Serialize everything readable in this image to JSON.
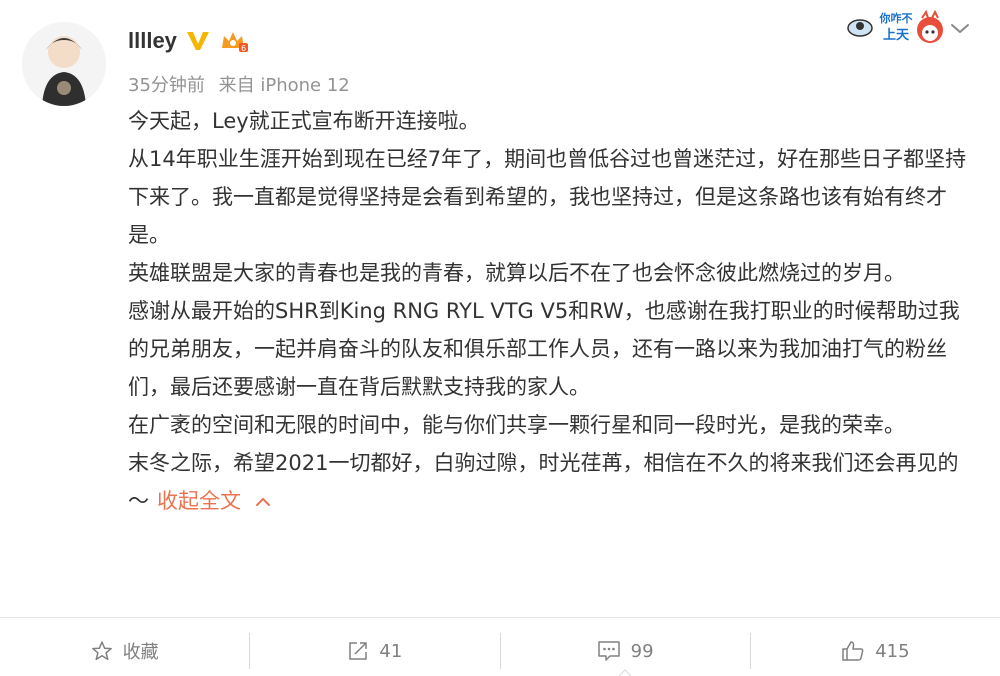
{
  "post": {
    "username": "lllley",
    "timestamp": "35分钟前",
    "source": "来自 iPhone 12",
    "paragraphs": [
      "今天起，Ley就正式宣布断开连接啦。",
      "  从14年职业生涯开始到现在已经7年了，期间也曾低谷过也曾迷茫过，好在那些日子都坚持下来了。我一直都是觉得坚持是会看到希望的，我也坚持过，但是这条路也该有始有终才是。",
      "  英雄联盟是大家的青春也是我的青春，就算以后不在了也会怀念彼此燃烧过的岁月。",
      "  感谢从最开始的SHR到King RNG RYL VTG V5和RW，也感谢在我打职业的时候帮助过我的兄弟朋友，一起并肩奋斗的队友和俱乐部工作人员，还有一路以来为我加油打气的粉丝们，最后还要感谢一直在背后默默支持我的家人。",
      "  在广袤的空间和无限的时间中，能与你们共享一颗行星和同一段时光，是我的荣幸。"
    ],
    "last_paragraph": "  末冬之际，希望2021一切都好，白驹过隙，时光荏苒，相信在不久的将来我们还会再见的～",
    "collapse_label": "收起全文",
    "sticker_text_top": "你咋不",
    "sticker_text_bottom": "上天"
  },
  "actions": {
    "favorite_label": "收藏",
    "reposts": "41",
    "comments": "99",
    "likes": "415"
  },
  "colors": {
    "link": "#eb7350",
    "verified": "#f7b500",
    "muted": "#939393"
  },
  "icons": [
    "avatar",
    "verified-icon",
    "vip-crown-icon",
    "sticker-icon",
    "chevron-down-icon",
    "chevron-up-icon",
    "star-icon",
    "repost-icon",
    "comment-icon",
    "like-icon"
  ]
}
